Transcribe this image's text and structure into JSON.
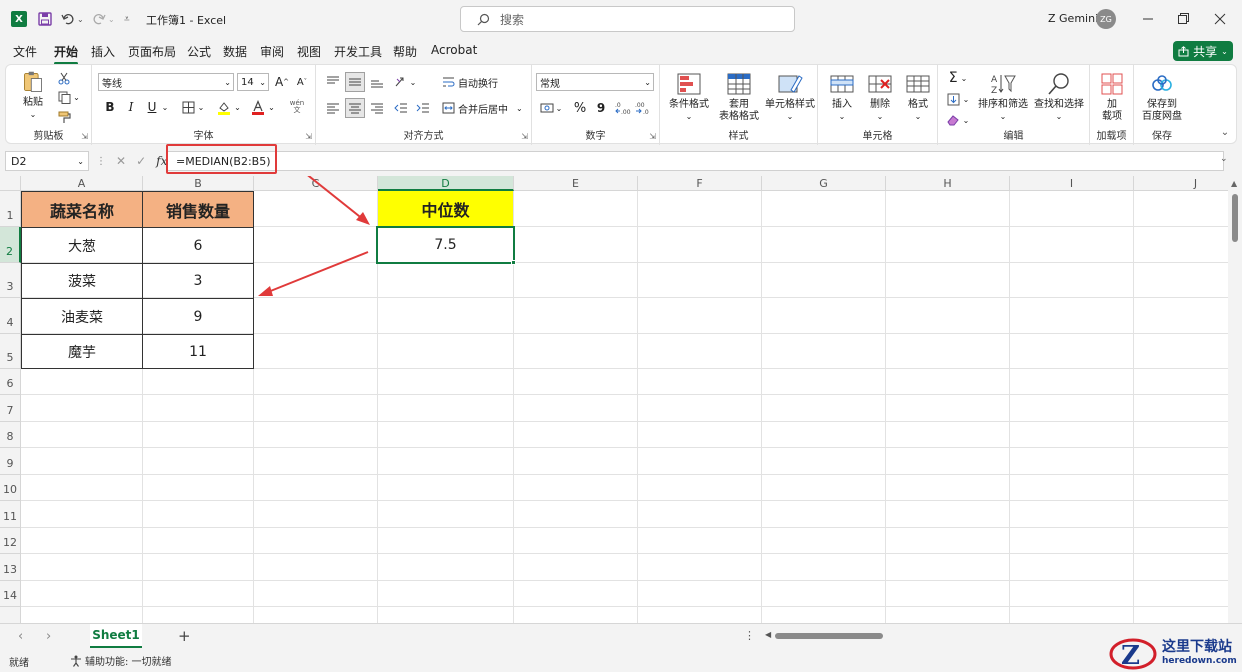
{
  "titlebar": {
    "app_logo": "X",
    "document_title": "工作簿1 - Excel",
    "search_placeholder": "搜索",
    "user_name": "Z Gemini",
    "user_initials": "ZG"
  },
  "menu": {
    "items": [
      "文件",
      "开始",
      "插入",
      "页面布局",
      "公式",
      "数据",
      "审阅",
      "视图",
      "开发工具",
      "帮助",
      "Acrobat"
    ],
    "active": "开始",
    "share_label": "共享"
  },
  "ribbon": {
    "clipboard": {
      "paste_label": "粘贴",
      "group_label": "剪贴板"
    },
    "font": {
      "font_name": "等线",
      "font_size": "14",
      "bold": "B",
      "italic": "I",
      "underline": "U",
      "grow": "A",
      "shrink": "A",
      "group_label": "字体"
    },
    "alignment": {
      "wrap_text_label": "自动换行",
      "merge_center_label": "合并后居中",
      "group_label": "对齐方式"
    },
    "number": {
      "format": "常规",
      "percent": "%",
      "comma": "9",
      "group_label": "数字"
    },
    "styles": {
      "conditional_label": "条件格式",
      "table_format_label_1": "套用",
      "table_format_label_2": "表格格式",
      "cell_styles_label": "单元格样式",
      "group_label": "样式"
    },
    "cells": {
      "insert_label": "插入",
      "delete_label": "删除",
      "format_label": "格式",
      "group_label": "单元格"
    },
    "editing": {
      "sort_filter_label": "排序和筛选",
      "find_select_label": "查找和选择",
      "group_label": "编辑"
    },
    "addins": {
      "label_1": "加",
      "label_2": "载项",
      "group_label": "加载项"
    },
    "save": {
      "label_1": "保存到",
      "label_2": "百度网盘",
      "group_label": "保存"
    }
  },
  "formula_bar": {
    "name_box": "D2",
    "formula": "=MEDIAN(B2:B5)"
  },
  "sheet": {
    "columns": [
      "A",
      "B",
      "C",
      "D",
      "E",
      "F",
      "G",
      "H",
      "I",
      "J"
    ],
    "rows": [
      "1",
      "2",
      "3",
      "4",
      "5",
      "6",
      "7",
      "8",
      "9",
      "10",
      "11",
      "12",
      "13",
      "14"
    ],
    "selected_column": "D",
    "selected_row": "2",
    "table": {
      "headers": [
        "蔬菜名称",
        "销售数量"
      ],
      "rows": [
        [
          "大葱",
          "6"
        ],
        [
          "菠菜",
          "3"
        ],
        [
          "油麦菜",
          "9"
        ],
        [
          "魔芋",
          "11"
        ]
      ]
    },
    "median": {
      "header": "中位数",
      "value": "7.5"
    },
    "colors": {
      "header_fill": "#f4b183",
      "median_fill": "#ffff00",
      "accent": "#107c41",
      "annotation": "#e03a3a"
    }
  },
  "tabs": {
    "sheet_name": "Sheet1",
    "add": "+"
  },
  "status": {
    "ready": "就绪",
    "accessibility": "辅助功能: 一切就绪"
  },
  "watermark": {
    "cn": "这里下载站",
    "en": "heredown.com"
  }
}
